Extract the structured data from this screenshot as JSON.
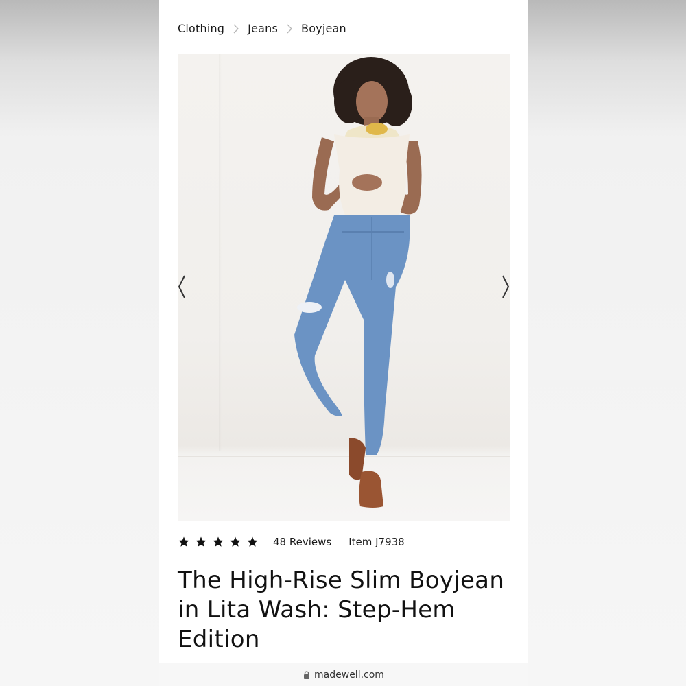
{
  "breadcrumb": {
    "items": [
      "Clothing",
      "Jeans",
      "Boyjean"
    ]
  },
  "gallery": {
    "prev_icon": "chevron-left-icon",
    "next_icon": "chevron-right-icon",
    "image_alt": "Model wearing The High-Rise Slim Boyjean in Lita Wash"
  },
  "rating": {
    "stars": 5,
    "max": 5,
    "reviews_label": "48 Reviews",
    "item_label": "Item J7938"
  },
  "product": {
    "title_lines": [
      "The High-Rise Slim Boyjean",
      "in Lita Wash: Step-Hem",
      "Edition"
    ]
  },
  "browser": {
    "url": "madewell.com",
    "lock_icon": "lock-icon"
  },
  "colors": {
    "text": "#1a1a1a",
    "denim": "#6b93c4",
    "background": "#ffffff"
  }
}
